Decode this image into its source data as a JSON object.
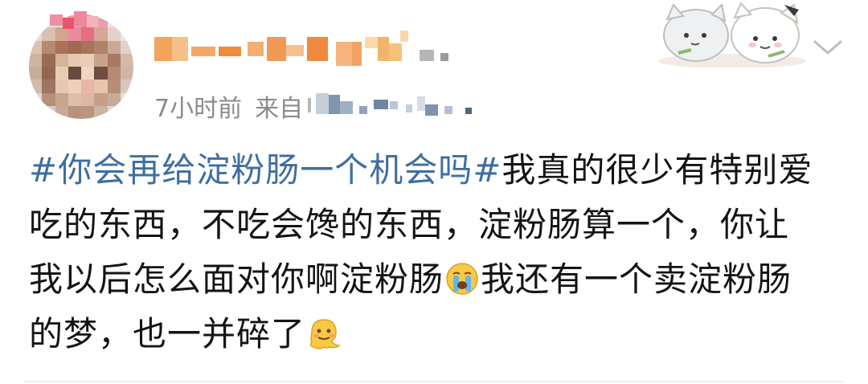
{
  "post": {
    "time": "7小时前",
    "source_prefix": "来自",
    "hashtag": "#你会再给淀粉肠一个机会吗#",
    "lines": [
      "我真的很少有特别爱",
      "吃的东西，不吃会馋的东西，淀粉肠算一个，你让",
      "我以后怎么面对你啊淀粉肠",
      "我还有一个卖淀粉肠",
      "的梦，也一并碎了"
    ]
  },
  "icons": {
    "more": "chevron-down-icon",
    "crying_emoji": "crying-face-emoji",
    "melting_emoji": "melting-face-emoji"
  },
  "colors": {
    "hashtag": "#3f6ea1",
    "meta_text": "#8b8b8b",
    "body_text": "#141414"
  }
}
